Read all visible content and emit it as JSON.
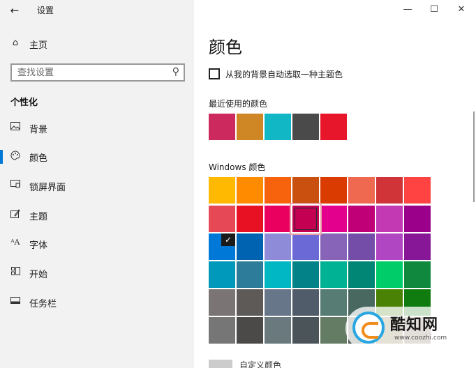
{
  "window": {
    "title": "设置",
    "back_icon": "arrow-left-icon",
    "buttons": [
      "minimize-icon",
      "maximize-icon",
      "close-icon"
    ]
  },
  "sidebar": {
    "home": {
      "label": "主页",
      "icon": "home-icon"
    },
    "search": {
      "placeholder": "查找设置",
      "icon": "search-icon"
    },
    "section": "个性化",
    "items": [
      {
        "label": "背景",
        "icon": "image-icon",
        "active": false
      },
      {
        "label": "颜色",
        "icon": "palette-icon",
        "active": true
      },
      {
        "label": "锁屏界面",
        "icon": "lock-screen-icon",
        "active": false
      },
      {
        "label": "主题",
        "icon": "theme-icon",
        "active": false
      },
      {
        "label": "字体",
        "icon": "font-icon",
        "active": false
      },
      {
        "label": "开始",
        "icon": "start-icon",
        "active": false
      },
      {
        "label": "任务栏",
        "icon": "taskbar-icon",
        "active": false
      }
    ],
    "accent_color": "#0078d7"
  },
  "main": {
    "title": "颜色",
    "auto_pick": {
      "label": "从我的背景自动选取一种主题色",
      "checked": false
    },
    "recent_label": "最近使用的颜色",
    "recent_colors": [
      "#cc2a5e",
      "#cf8726",
      "#11b7c4",
      "#4a4a4a",
      "#e8162a"
    ],
    "windows_label": "Windows 颜色",
    "windows_colors": [
      [
        "#ffb900",
        "#ff8c00",
        "#f7630c",
        "#ca5010",
        "#da3b01",
        "#ef6950",
        "#d13438",
        "#ff4343"
      ],
      [
        "#e74856",
        "#e81123",
        "#ea005e",
        "#c30052",
        "#e3008c",
        "#bf0077",
        "#c239b3",
        "#9a0089"
      ],
      [
        "#0078d7",
        "#0063b1",
        "#8e8cd8",
        "#6b69d6",
        "#8764b8",
        "#744da9",
        "#b146c2",
        "#881798"
      ],
      [
        "#0099bc",
        "#2d7d9a",
        "#00b7c3",
        "#038387",
        "#00b294",
        "#018574",
        "#00cc6a",
        "#10893e"
      ],
      [
        "#7a7574",
        "#5d5a58",
        "#68768a",
        "#515c6b",
        "#567c73",
        "#486860",
        "#498205",
        "#107c10"
      ],
      [
        "#767676",
        "#4c4a48",
        "#69797e",
        "#4a5459",
        "#647c64",
        "#525e54",
        "#847545",
        "#7e735f"
      ]
    ],
    "selected": {
      "row": 2,
      "col": 0
    },
    "highlighted": {
      "row": 1,
      "col": 3
    },
    "custom_label": "自定义颜色",
    "check_icon": "checkmark-icon"
  },
  "watermark": {
    "name": "酷知网",
    "url": "www.coozhi.com",
    "logo": "coozhi-logo-icon"
  }
}
